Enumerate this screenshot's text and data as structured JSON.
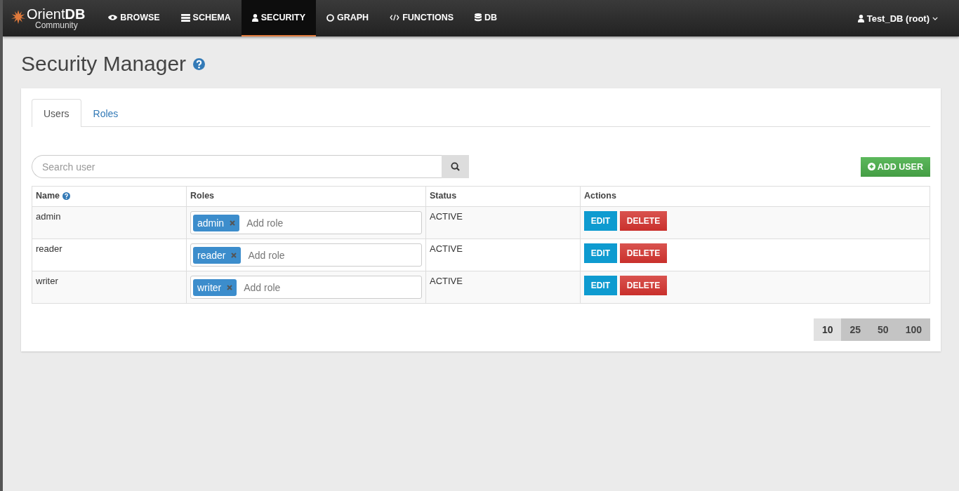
{
  "navbar": {
    "logo": {
      "brand": "Orient**DB**",
      "edition": "Community"
    },
    "items": [
      {
        "label": "BROWSE",
        "selected": false
      },
      {
        "label": "SCHEMA",
        "selected": false
      },
      {
        "label": "SECURITY",
        "selected": true
      },
      {
        "label": "GRAPH",
        "selected": false
      },
      {
        "label": "FUNCTIONS",
        "selected": false
      },
      {
        "label": "DB",
        "selected": false
      }
    ],
    "user_menu": "Test_DB (root)"
  },
  "page_title": "Security Manager",
  "tabs": [
    {
      "label": "Users",
      "selected": true
    },
    {
      "label": "Roles",
      "selected": false
    }
  ],
  "search": {
    "placeholder": "Search user"
  },
  "add_button": "ADD USER",
  "table": {
    "columns": [
      "Name",
      "Roles",
      "Status",
      "Actions"
    ],
    "rows": [
      {
        "name": "admin",
        "roles": [
          "admin"
        ],
        "role_placeholder": "Add role",
        "status": "ACTIVE",
        "actions": [
          "EDIT",
          "DELETE"
        ]
      },
      {
        "name": "reader",
        "roles": [
          "reader"
        ],
        "role_placeholder": "Add role",
        "status": "ACTIVE",
        "actions": [
          "EDIT",
          "DELETE"
        ]
      },
      {
        "name": "writer",
        "roles": [
          "writer"
        ],
        "role_placeholder": "Add role",
        "status": "ACTIVE",
        "actions": [
          "EDIT",
          "DELETE"
        ]
      }
    ]
  },
  "page_sizes": [
    {
      "label": "10",
      "selected": true
    },
    {
      "label": "25",
      "selected": false
    },
    {
      "label": "50",
      "selected": false
    },
    {
      "label": "100",
      "selected": false
    }
  ]
}
